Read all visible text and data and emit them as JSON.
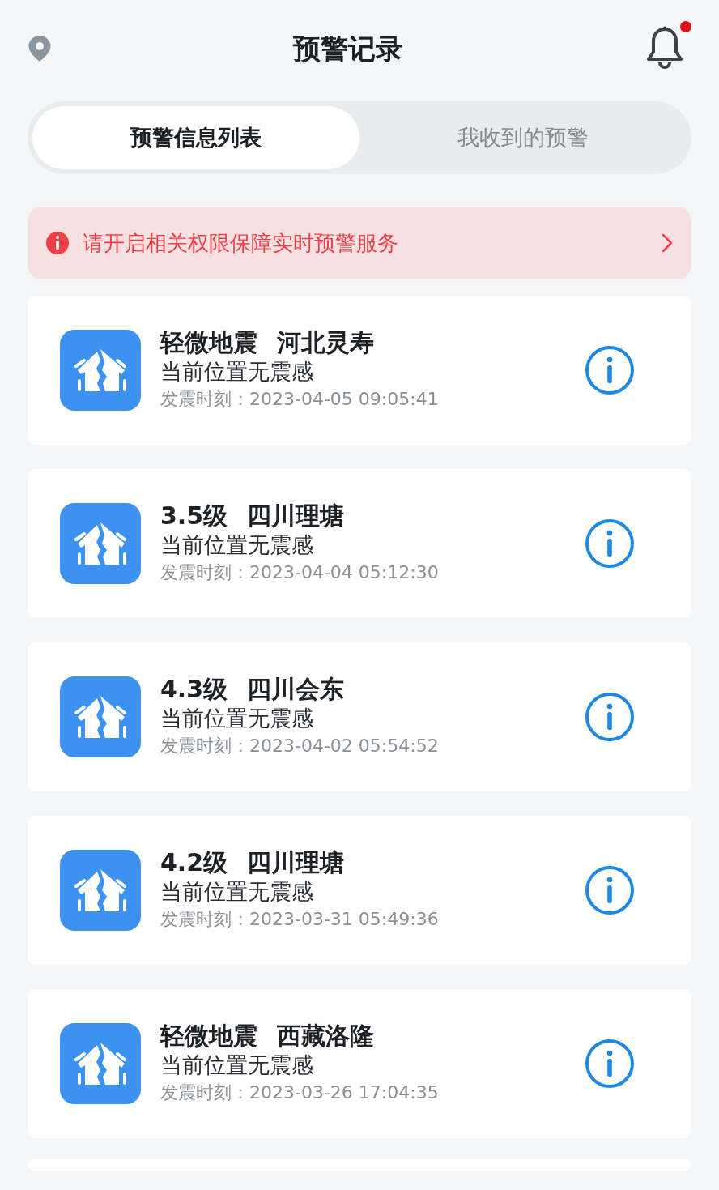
{
  "header": {
    "title": "预警记录",
    "notification_unread": true
  },
  "tabs": [
    {
      "label": "预警信息列表",
      "selected": true
    },
    {
      "label": "我收到的预警",
      "selected": false
    }
  ],
  "banner": {
    "text": "请开启相关权限保障实时预警服务"
  },
  "records": [
    {
      "magnitude": "轻微地震",
      "place": "河北灵寿",
      "felt": "当前位置无震感",
      "time_label": "发震时刻：",
      "time": "2023-04-05 09:05:41"
    },
    {
      "magnitude": "3.5级",
      "place": "四川理塘",
      "felt": "当前位置无震感",
      "time_label": "发震时刻：",
      "time": "2023-04-04 05:12:30"
    },
    {
      "magnitude": "4.3级",
      "place": "四川会东",
      "felt": "当前位置无震感",
      "time_label": "发震时刻：",
      "time": "2023-04-02 05:54:52"
    },
    {
      "magnitude": "4.2级",
      "place": "四川理塘",
      "felt": "当前位置无震感",
      "time_label": "发震时刻：",
      "time": "2023-03-31 05:49:36"
    },
    {
      "magnitude": "轻微地震",
      "place": "西藏洛隆",
      "felt": "当前位置无震感",
      "time_label": "发震时刻：",
      "time": "2023-03-26 17:04:35"
    }
  ]
}
